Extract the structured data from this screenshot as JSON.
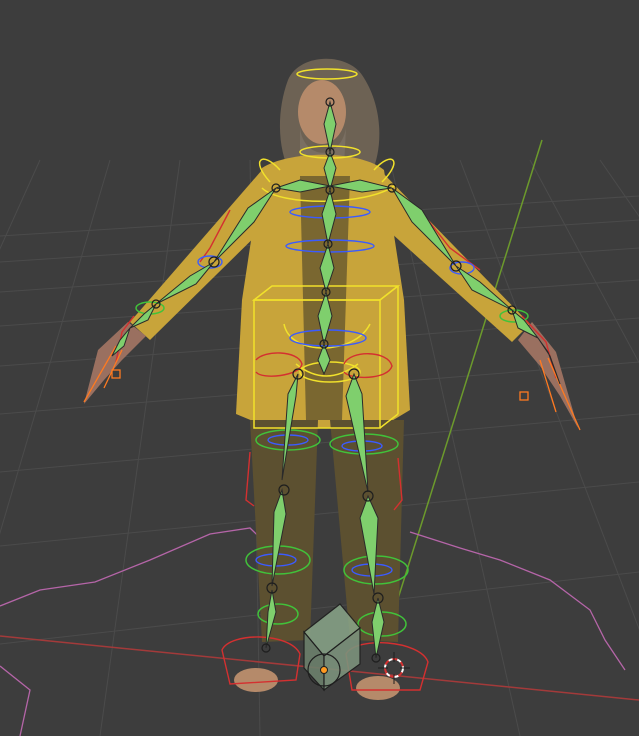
{
  "viewport": {
    "mode": "3d-viewport",
    "content": "rigged-character-armature",
    "colors": {
      "background": "#3d3d3d",
      "grid_line": "#4a4a4a",
      "axis_x": "#a33a3a",
      "axis_y": "#6c9a2c",
      "bone_fill": "#7fcf6d",
      "bone_stroke": "#2a2a2a",
      "control_blue": "#3b5bff",
      "control_red": "#d43030",
      "control_yellow": "#f1e12b",
      "control_green": "#41c23a",
      "control_orange": "#ff7a20",
      "outline_pink": "#b565a8",
      "jacket": "#c8a43a",
      "pants": "#5c5030",
      "skin": "#b58a6a",
      "hair": "#6d6254"
    },
    "icons": {
      "cursor": "3d-cursor-icon",
      "origin": "object-origin-icon"
    }
  }
}
